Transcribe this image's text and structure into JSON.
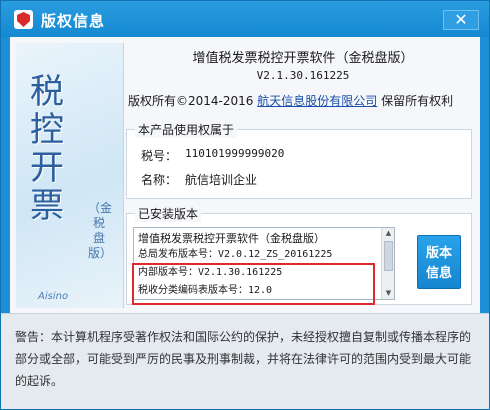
{
  "window": {
    "title": "版权信息",
    "close_label": "✕"
  },
  "banner": {
    "big_text": [
      "税",
      "控",
      "开",
      "票"
    ],
    "vertical_text": "（金税盘版）",
    "brand": "Aisino"
  },
  "header": {
    "product_title": "增值税发票税控开票软件（金税盘版）",
    "product_version": "V2.1.30.161225",
    "copyright_prefix": "版权所有©2014-2016",
    "company_link": "航天信息股份有限公司",
    "copyright_suffix": "保留所有权利"
  },
  "license": {
    "legend": "本产品使用权属于",
    "tax_id_label": "税号：",
    "tax_id_value": "110101999999020",
    "name_label": "名称：",
    "name_value": "航信培训企业"
  },
  "installed": {
    "legend": "已安装版本",
    "lines": [
      "增值税发票税控开票软件（金税盘版）",
      "总局发布版本号：V2.0.12_ZS_20161225",
      "内部版本号：V2.1.30.161225",
      "税收分类编码表版本号：12.0"
    ],
    "version_button_line1": "版本",
    "version_button_line2": "信息",
    "highlight_color": "#e0282e"
  },
  "footer": {
    "warning": "警告：本计算机程序受著作权法和国际公约的保护，未经授权擅自复制或传播本程序的部分或全部，可能受到严厉的民事及刑事制裁，并将在法律许可的范围内受到最大可能的起诉。"
  },
  "colors": {
    "titlebar": "#1c8fd6",
    "accent": "#1a4ea8"
  }
}
